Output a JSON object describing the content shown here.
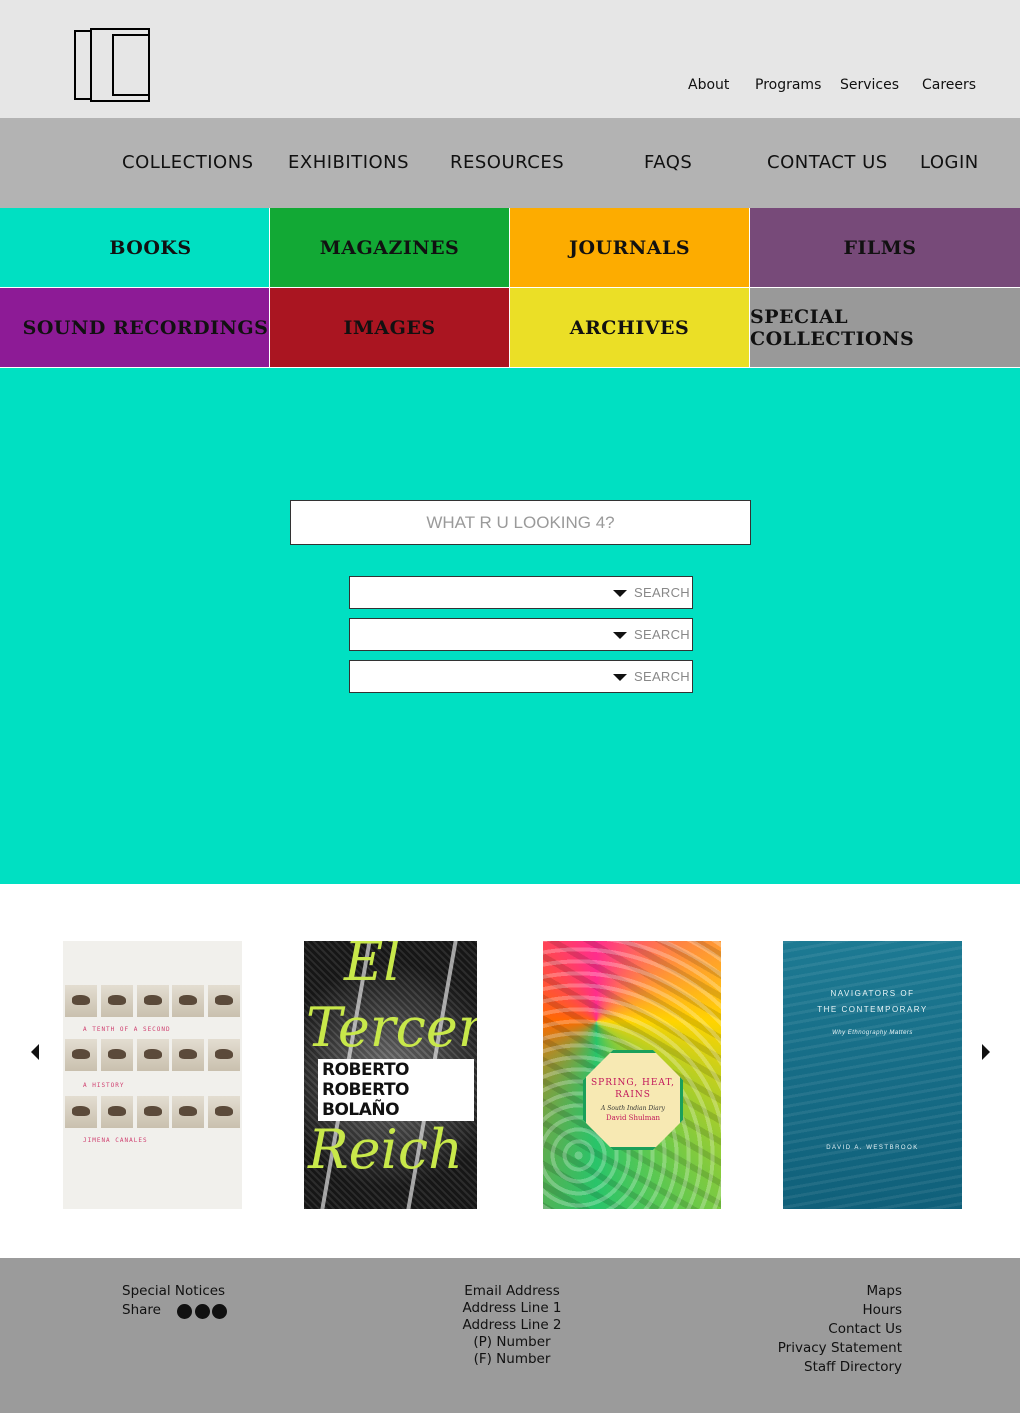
{
  "header": {
    "utility_nav": [
      "About",
      "Programs",
      "Services",
      "Careers"
    ]
  },
  "main_nav": [
    "COLLECTIONS",
    "EXHIBITIONS",
    "RESOURCES",
    "FAQS",
    "CONTACT US",
    "LOGIN"
  ],
  "categories": [
    {
      "label": "BOOKS",
      "color": "#00e0c2"
    },
    {
      "label": "MAGAZINES",
      "color": "#12a935"
    },
    {
      "label": "JOURNALS",
      "color": "#fdac00"
    },
    {
      "label": "FILMS",
      "color": "#774a79"
    },
    {
      "label": "SOUND RECORDINGS",
      "color": "#8d1b96"
    },
    {
      "label": "IMAGES",
      "color": "#aa1521"
    },
    {
      "label": "ARCHIVES",
      "color": "#ebdf26"
    },
    {
      "label": "SPECIAL COLLECTIONS",
      "color": "#999999"
    }
  ],
  "search": {
    "placeholder": "WHAT R U LOOKING 4?",
    "filters": [
      {
        "value": "",
        "button": "SEARCH"
      },
      {
        "value": "",
        "button": "SEARCH"
      },
      {
        "value": "",
        "button": "SEARCH"
      }
    ]
  },
  "carousel": {
    "covers": [
      {
        "title": "A TENTH OF A SECOND",
        "subtitle": "A HISTORY",
        "author": "JIMENA CANALES"
      },
      {
        "title_script_1": "El",
        "title_script_2": "Tercer",
        "title_script_3": "Reich",
        "author": "ROBERTO BOLAÑO",
        "author_echo": "ROBERTO BOLAÑO"
      },
      {
        "title": "SPRING, HEAT, RAINS",
        "subtitle": "A South Indian Diary",
        "author": "David Shulman"
      },
      {
        "title_line_1": "NAVIGATORS OF",
        "title_line_2": "THE CONTEMPORARY",
        "subtitle": "Why Ethnography Matters",
        "author": "DAVID A. WESTBROOK"
      }
    ]
  },
  "footer": {
    "left": {
      "special_notices": "Special Notices",
      "share": "Share"
    },
    "center": [
      "Email Address",
      "Address Line 1",
      "Address Line 2",
      "(P) Number",
      "(F) Number"
    ],
    "right": [
      "Maps",
      "Hours",
      "Contact Us",
      "Privacy Statement",
      "Staff Directory"
    ]
  },
  "colors": {
    "topbar": "#e6e6e6",
    "mainnav": "#b3b3b3",
    "hero": "#00e0c2",
    "footer": "#9b9b9b"
  }
}
